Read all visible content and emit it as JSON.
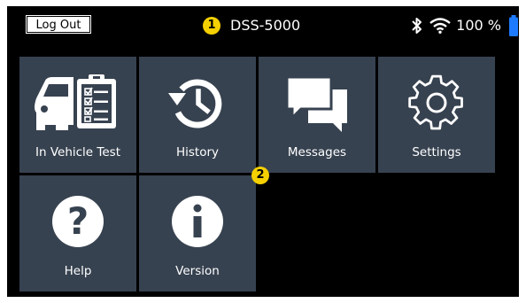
{
  "status_bar": {
    "logout_label": "Log Out",
    "device_name": "DSS-5000",
    "battery_percent": "100 %",
    "icons": [
      "bluetooth-icon",
      "wifi-icon",
      "battery-icon"
    ]
  },
  "markers": [
    "1",
    "2"
  ],
  "tiles": [
    {
      "label": "In Vehicle Test",
      "icon": "vehicle-test-icon"
    },
    {
      "label": "History",
      "icon": "history-icon"
    },
    {
      "label": "Messages",
      "icon": "messages-icon"
    },
    {
      "label": "Settings",
      "icon": "settings-icon"
    },
    {
      "label": "Help",
      "icon": "help-icon"
    },
    {
      "label": "Version",
      "icon": "version-info-icon"
    }
  ],
  "colors": {
    "background": "#000000",
    "tile": "#374250",
    "marker": "#f5d000",
    "battery": "#1e7bff"
  }
}
